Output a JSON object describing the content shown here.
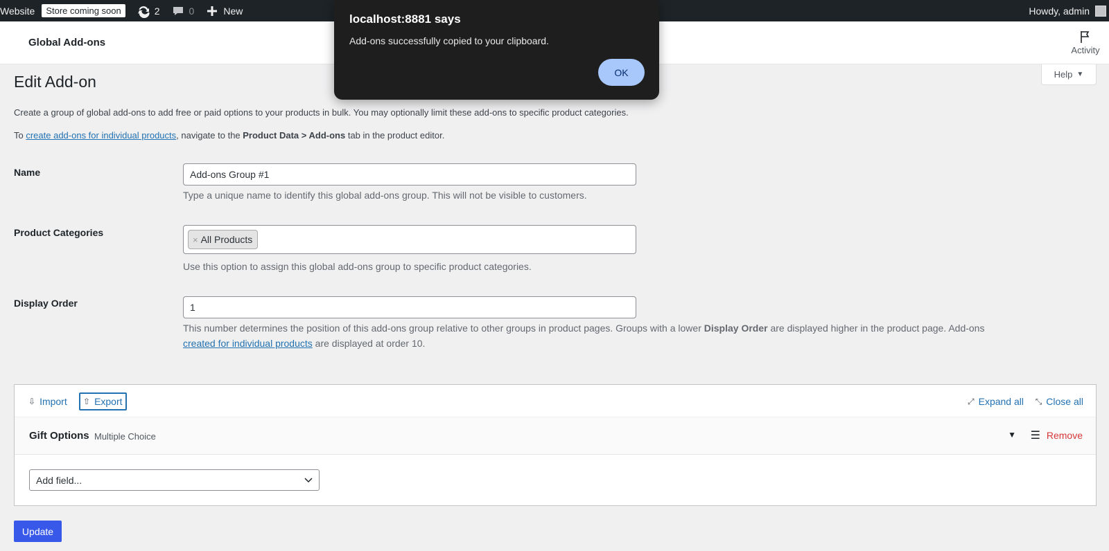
{
  "admin_bar": {
    "site": "Website",
    "badge": "Store coming soon",
    "updates_count": "2",
    "comments_count": "0",
    "new_label": "New",
    "howdy": "Howdy, admin"
  },
  "header": {
    "title": "Global Add-ons",
    "activity_label": "Activity",
    "help_label": "Help"
  },
  "page": {
    "title": "Edit Add-on",
    "description": "Create a group of global add-ons to add free or paid options to your products in bulk. You may optionally limit these add-ons to specific product categories.",
    "note_prefix": "To ",
    "note_link": "create add-ons for individual products",
    "note_mid": ", navigate to the ",
    "note_bold": "Product Data > Add-ons",
    "note_suffix": " tab in the product editor."
  },
  "form": {
    "name_label": "Name",
    "name_value": "Add-ons Group #1",
    "name_help": "Type a unique name to identify this global add-ons group. This will not be visible to customers.",
    "categories_label": "Product Categories",
    "category_chip": "All Products",
    "category_chip_remove": "×",
    "categories_help": "Use this option to assign this global add-ons group to specific product categories.",
    "order_label": "Display Order",
    "order_value": "1",
    "order_help_1": "This number determines the position of this add-ons group relative to other groups in product pages. Groups with a lower ",
    "order_help_bold": "Display Order",
    "order_help_2": " are displayed higher in the product page. Add-ons",
    "order_help_link": "created for individual products",
    "order_help_3": " are displayed at order 10."
  },
  "addons_panel": {
    "import_label": "Import",
    "export_label": "Export",
    "expand_all_label": "Expand all",
    "close_all_label": "Close all",
    "addon": {
      "name": "Gift Options",
      "type": "Multiple Choice",
      "remove_label": "Remove"
    },
    "add_field_placeholder": "Add field..."
  },
  "update_button": "Update",
  "dialog": {
    "title": "localhost:8881 says",
    "message": "Add-ons successfully copied to your clipboard.",
    "ok_label": "OK"
  },
  "icons": {
    "updates": "refresh-icon",
    "comments": "comment-icon",
    "new": "plus-icon",
    "activity": "flag-icon",
    "import": "import-icon",
    "export": "export-icon",
    "expand": "expand-icon",
    "close": "collapse-icon",
    "drag": "drag-handle-icon"
  },
  "colors": {
    "admin_bar_bg": "#1d2327",
    "link": "#2271b1",
    "remove": "#d63638",
    "update_button": "#3858e9",
    "dialog_bg": "#1e1e1e",
    "dialog_ok": "#a8c7fa"
  }
}
